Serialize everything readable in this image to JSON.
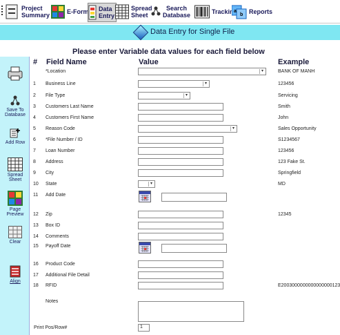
{
  "toolbar": {
    "items": [
      {
        "line1": "Project",
        "line2": "Summary",
        "icon": "project-summary-icon"
      },
      {
        "line1": "E-Forms",
        "line2": "",
        "icon": "eforms-icon"
      },
      {
        "line1": "Data",
        "line2": "Entry",
        "icon": "data-entry-icon"
      },
      {
        "line1": "Spread",
        "line2": "Sheet",
        "icon": "spreadsheet-icon"
      },
      {
        "line1": "Search",
        "line2": "Database",
        "icon": "search-database-icon"
      },
      {
        "line1": "Tracking",
        "line2": "",
        "icon": "barcode-icon"
      },
      {
        "line1": "Reports",
        "line2": "",
        "icon": "reports-icon"
      }
    ]
  },
  "banner": {
    "title": "Data Entry for Single File"
  },
  "instruction": "Please enter Variable data values for each field below",
  "table": {
    "headers": {
      "num": "#",
      "field": "Field Name",
      "value": "Value",
      "example": "Example"
    }
  },
  "sidebar": {
    "save_label_1": "Save To",
    "save_label_2": "Database",
    "addrow_label": "Add Row",
    "spread_label_1": "Spread",
    "spread_label_2": "Sheet",
    "preview_label_1": "Page",
    "preview_label_2": "Preview",
    "clear_label": "Clear",
    "align_label": "Align"
  },
  "fields": [
    {
      "num": "",
      "name": "*Location",
      "example": "BANK OF MANH"
    },
    {
      "num": "1",
      "name": "Business Line",
      "example": "123456"
    },
    {
      "num": "2",
      "name": "File Type",
      "example": "Servicing"
    },
    {
      "num": "3",
      "name": "Customers Last Name",
      "example": "Smith"
    },
    {
      "num": "4",
      "name": "Customers First Name",
      "example": "John"
    },
    {
      "num": "5",
      "name": "Reason Code",
      "example": "Sales Opportunity"
    },
    {
      "num": "6",
      "name": "*File Number / ID",
      "example": "S1234567"
    },
    {
      "num": "7",
      "name": "Loan Number",
      "example": "123456"
    },
    {
      "num": "8",
      "name": "Address",
      "example": "123 Fake St."
    },
    {
      "num": "9",
      "name": "City",
      "example": "Springfield"
    },
    {
      "num": "10",
      "name": "State",
      "example": "MD"
    },
    {
      "num": "11",
      "name": "Add Date",
      "example": ""
    },
    {
      "num": "12",
      "name": "Zip",
      "example": "12345"
    },
    {
      "num": "13",
      "name": "Box ID",
      "example": ""
    },
    {
      "num": "14",
      "name": "Comments",
      "example": ""
    },
    {
      "num": "15",
      "name": "Payoff Date",
      "example": ""
    },
    {
      "num": "16",
      "name": "Product Code",
      "example": ""
    },
    {
      "num": "17",
      "name": "Additional File Detail",
      "example": ""
    },
    {
      "num": "18",
      "name": "RFID",
      "example": "E2003000000000000000123"
    }
  ],
  "notes_label": "Notes",
  "print_pos_label": "Print Pos/Row#",
  "print_pos_value": "1",
  "colors": {
    "banner": "#7fe7f2",
    "sidebar": "#c3f3fa"
  }
}
